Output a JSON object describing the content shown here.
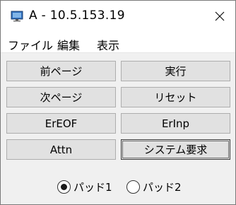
{
  "window": {
    "title": "A - 10.5.153.19",
    "icon": "monitor-icon",
    "close_icon": "close-icon"
  },
  "menu": {
    "items": [
      {
        "label": "ファイル"
      },
      {
        "label": "編集"
      },
      {
        "label": "表示"
      }
    ]
  },
  "buttons": {
    "prev_page": "前ページ",
    "execute": "実行",
    "next_page": "次ページ",
    "reset": "リセット",
    "er_eof": "ErEOF",
    "er_inp": "ErInp",
    "attn": "Attn",
    "system_request": "システム要求"
  },
  "pad_select": {
    "options": [
      {
        "label": "パッド1",
        "selected": true
      },
      {
        "label": "パッド2",
        "selected": false
      }
    ]
  },
  "colors": {
    "window_bg": "#f0f0f0",
    "titlebar_bg": "#ffffff",
    "button_bg": "#e1e1e1",
    "button_border": "#adadad"
  }
}
